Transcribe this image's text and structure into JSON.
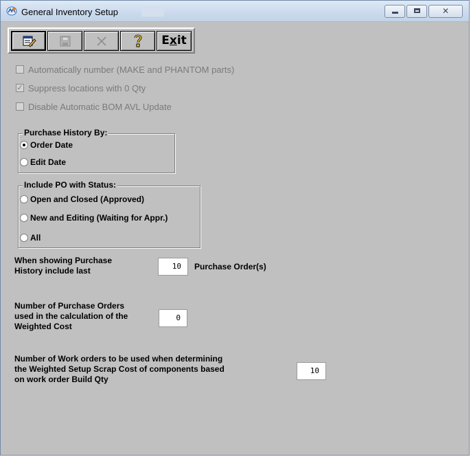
{
  "window": {
    "title": "General Inventory Setup",
    "minimize_glyph": "",
    "close_glyph": "✕"
  },
  "toolbar": {
    "edit_icon": "edit-icon",
    "save_icon": "save-icon",
    "cancel_icon": "x-icon",
    "help_icon": "help-icon",
    "exit_label_pre": "E",
    "exit_label_accel": "x",
    "exit_label_post": "it"
  },
  "options": {
    "auto_number": {
      "label": "Automatically number (MAKE and PHANTOM parts)",
      "checked": false
    },
    "suppress_locations": {
      "label": "Suppress locations with 0 Qty",
      "checked": true,
      "mark": "✓"
    },
    "disable_bom_avl": {
      "label": "Disable Automatic BOM AVL Update",
      "checked": false
    }
  },
  "purchase_history": {
    "title": "Purchase History By:",
    "options": [
      {
        "label": "Order Date",
        "selected": true
      },
      {
        "label": "Edit Date",
        "selected": false
      }
    ]
  },
  "po_status": {
    "title": "Include PO with Status:",
    "options": [
      {
        "label": "Open and Closed (Approved)",
        "selected": false
      },
      {
        "label": "New and Editing (Waiting for Appr.)",
        "selected": false
      },
      {
        "label": "All",
        "selected": false
      }
    ]
  },
  "fields": {
    "history_label_1": "When showing Purchase",
    "history_label_2": "History include last",
    "history_value": "10",
    "history_suffix": "Purchase Order(s)",
    "weighted_label_1": "Number of Purchase Orders",
    "weighted_label_2": "used in the calculation of the",
    "weighted_label_3": "Weighted Cost",
    "weighted_value": "0",
    "wo_label_1": "Number of Work orders to be used when determining",
    "wo_label_2": "the Weighted Setup Scrap Cost of components based",
    "wo_label_3": "on work order Build Qty",
    "wo_value": "10"
  }
}
